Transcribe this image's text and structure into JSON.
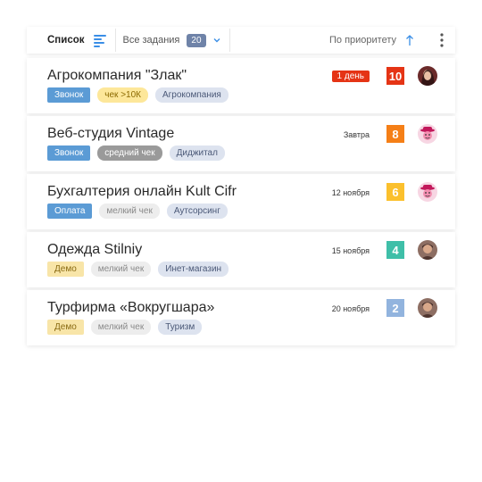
{
  "toolbar": {
    "title": "Список",
    "filter_label": "Все задания",
    "filter_count": "20",
    "sort_label": "По приоритету"
  },
  "colors": {
    "accent": "#3a8ee6",
    "date_badge": "#e53415",
    "prio_10": "#e53415",
    "prio_8": "#f57f17",
    "prio_6": "#fbc02d",
    "prio_4": "#3fbfa8",
    "prio_2": "#92b4de"
  },
  "cards": [
    {
      "title": "Агрокомпания \"Злак\"",
      "date": "1 день",
      "date_urgent": true,
      "priority": "10",
      "priority_color": "#e53415",
      "avatar": "woman-avatar",
      "tags": {
        "type": "Звонок",
        "value": "чек >10К",
        "industry": "Агрокомпания"
      }
    },
    {
      "title": "Веб-студия Vintage",
      "date": "Завтра",
      "date_urgent": false,
      "priority": "8",
      "priority_color": "#f57f17",
      "avatar": "cowboy-avatar",
      "tags": {
        "type": "Звонок",
        "value": "средний чек",
        "industry": "Диджитал"
      }
    },
    {
      "title": "Бухгалтерия онлайн Kult Cifr",
      "date": "12 ноября",
      "date_urgent": false,
      "priority": "6",
      "priority_color": "#fbc02d",
      "avatar": "cowboy-avatar",
      "tags": {
        "type": "Оплата",
        "value": "мелкий чек",
        "industry": "Аутсорсинг"
      }
    },
    {
      "title": "Одежда Stilniy",
      "date": "15 ноября",
      "date_urgent": false,
      "priority": "4",
      "priority_color": "#3fbfa8",
      "avatar": "man-avatar",
      "tags": {
        "type": "Демо",
        "value": "мелкий чек",
        "industry": "Инет-магазин"
      }
    },
    {
      "title": "Турфирма «Вокругшара»",
      "date": "20 ноября",
      "date_urgent": false,
      "priority": "2",
      "priority_color": "#92b4de",
      "avatar": "man-avatar",
      "tags": {
        "type": "Демо",
        "value": "мелкий чек",
        "industry": "Туризм"
      }
    }
  ]
}
